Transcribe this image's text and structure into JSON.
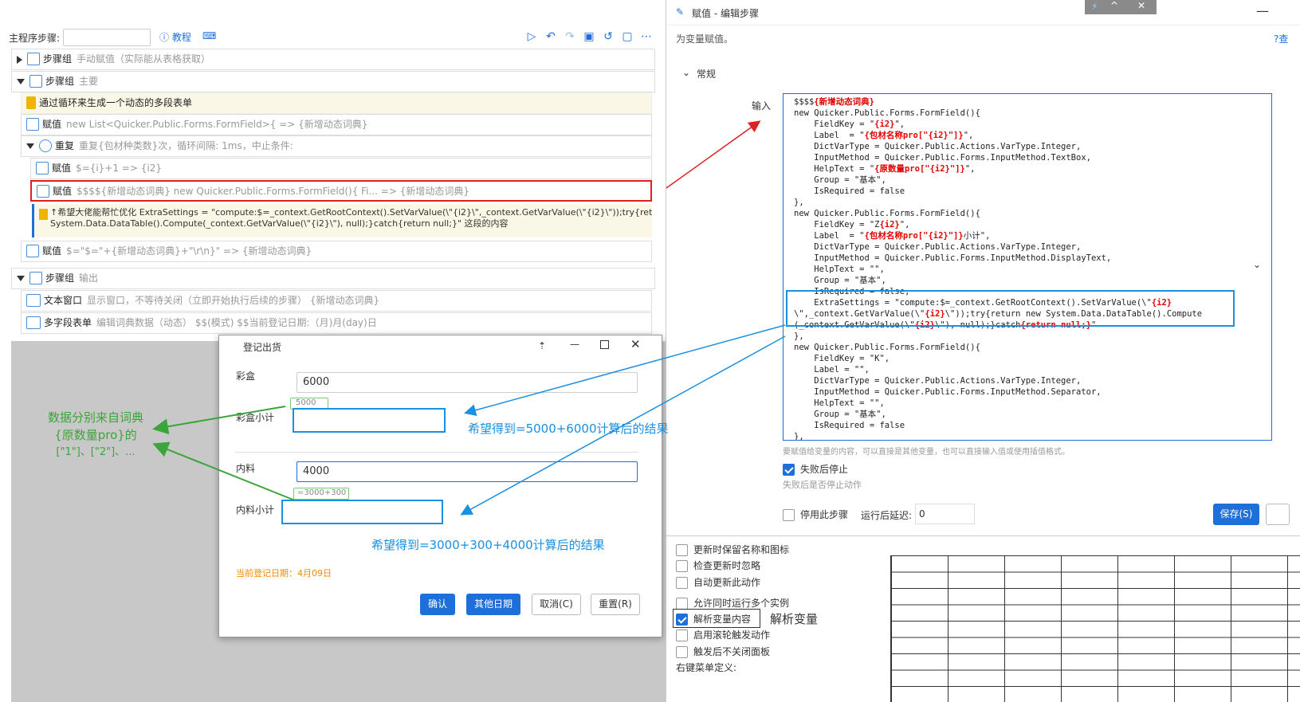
{
  "toolbar": {
    "step_label": "主程序步骤:",
    "tutorial": "教程"
  },
  "tree": {
    "g1": {
      "name": "步骤组",
      "desc": "手动赋值（实际能从表格获取）"
    },
    "g2": {
      "name": "步骤组",
      "desc": "主要"
    },
    "note": "通过循环来生成一个动态的多段表单",
    "assign1": {
      "name": "赋值",
      "desc": "new List<Quicker.Public.Forms.FormField>{ => {新增动态词典}"
    },
    "repeat": {
      "name": "重复",
      "desc": "重复{包材种类数}次，循环间隔: 1ms，中止条件:"
    },
    "assign2": {
      "name": "赋值",
      "desc": "$={i}+1 => {i2}"
    },
    "assign3": {
      "name": "赋值",
      "desc": "$$$${新增动态词典}  new Quicker.Public.Forms.FormField(){                              Fi... => {新增动态词典}"
    },
    "note2_line1": "↑希望大佬能帮忙优化 ExtraSettings = \"compute:$=_context.GetRootContext().SetVarValue(\\\"{i2}\\\",_context.GetVarValue(\\\"{i2}\\\"));try{return new",
    "note2_line2": "System.Data.DataTable().Compute(_context.GetVarValue(\\\"{i2}\\\"), null);}catch{return null;}\" 这段的内容",
    "assign4": {
      "name": "赋值",
      "desc": "$=\"$=\"+{新增动态词典}+\"\\r\\n}\" => {新增动态词典}"
    },
    "g3": {
      "name": "步骤组",
      "desc": "输出"
    },
    "textwin": {
      "name": "文本窗口",
      "desc": "显示窗口，不等待关闭（立即开始执行后续的步骤）  {新增动态词典}"
    },
    "multiform": {
      "name": "多字段表单",
      "desc": "编辑词典数据（动态）  $$(模式) $$当前登记日期:（月)月(day)日"
    }
  },
  "right": {
    "title": "赋值 - 编辑步骤",
    "subtitle": "为变量赋值。",
    "help": "查",
    "section": "常规",
    "input_label": "输入",
    "hint": "要赋值给变量的内容，可以直接是其他变量，也可以直接输入值或使用插值格式。",
    "stop_on_fail": "失败后停止",
    "stop_on_fail_hint": "失败后是否停止动作",
    "disable_step": "停用此步骤",
    "delay_label": "运行后延迟:",
    "delay_value": "0",
    "save": "保存(S)",
    "opt1": "更新时保留名称和图标",
    "opt2": "检查更新时忽略",
    "opt3": "自动更新此动作",
    "opt4": "允许同时运行多个实例",
    "opt5": "解析变量内容",
    "opt6": "启用滚轮触发动作",
    "opt7": "触发后不关闭面板",
    "opt8": "右键菜单定义:",
    "parse_note": "解析变量"
  },
  "code_lines": [
    "$$$${新增动态词典}",
    "new Quicker.Public.Forms.FormField(){",
    "    FieldKey = \"{i2}\",",
    "    Label  = \"{包材名称pro[\"{i2}\"]}\",",
    "    DictVarType = Quicker.Public.Actions.VarType.Integer,",
    "    InputMethod = Quicker.Public.Forms.InputMethod.TextBox,",
    "    HelpText = \"{原数量pro[\"{i2}\"]}\",",
    "    Group = \"基本\",",
    "    IsRequired = false",
    "},",
    "new Quicker.Public.Forms.FormField(){",
    "    FieldKey = \"Z{i2}\",",
    "    Label  = \"{包材名称pro[\"{i2}\"]}小计\",",
    "    DictVarType = Quicker.Public.Actions.VarType.Integer,",
    "    InputMethod = Quicker.Public.Forms.InputMethod.DisplayText,",
    "    HelpText = \"\",",
    "    Group = \"基本\",",
    "    IsRequired = false,",
    "    ExtraSettings = \"compute:$=_context.GetRootContext().SetVarValue(\\\"{i2}",
    "\\\",_context.GetVarValue(\\\"{i2}\\\"));try{return new System.Data.DataTable().Compute",
    "(_context.GetVarValue(\\\"{i2}\\\"), null);}catch{return null;}\"",
    "},",
    "new Quicker.Public.Forms.FormField(){",
    "    FieldKey = \"K\",",
    "    Label = \"\",",
    "    DictVarType = Quicker.Public.Actions.VarType.Integer,",
    "    InputMethod = Quicker.Public.Forms.InputMethod.Separator,",
    "    HelpText = \"\",",
    "    Group = \"基本\",",
    "    IsRequired = false",
    "},"
  ],
  "dialog": {
    "title": "登记出货",
    "f1_label": "彩盒",
    "f1_value": "6000",
    "f1_hint": "5000",
    "f2_label": "彩盒小计",
    "f3_label": "内料",
    "f3_value": "4000",
    "f3_hint": "=3000+300",
    "f4_label": "内料小计",
    "date_text": "当前登记日期：4月09日",
    "confirm": "确认",
    "other_date": "其他日期",
    "cancel": "取消(C)",
    "reset": "重置(R)"
  },
  "annotations": {
    "a1": "希望得到=5000+6000计算后的结果",
    "a2": "希望得到=3000+300+4000计算后的结果",
    "green1": "数据分别来自词典",
    "green2": "{原数量pro}的",
    "green3": "[\"1\"]、[\"2\"]、..."
  }
}
